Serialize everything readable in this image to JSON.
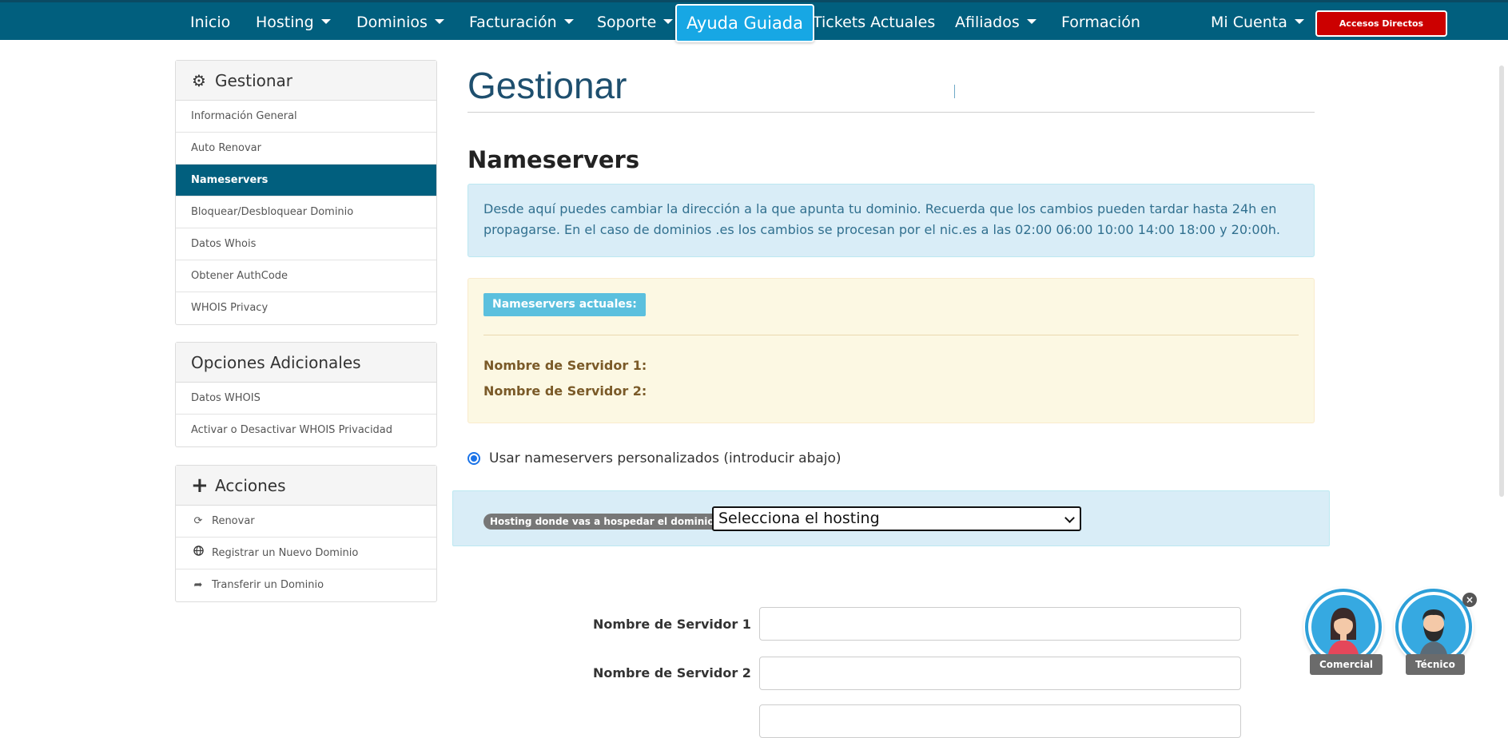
{
  "nav": {
    "inicio": "Inicio",
    "hosting": "Hosting",
    "dominios": "Dominios",
    "facturacion": "Facturación",
    "soporte": "Soporte",
    "ayuda_guiada": "Ayuda Guiada",
    "tickets": "Tickets Actuales",
    "afiliados": "Afiliados",
    "formacion": "Formación",
    "mi_cuenta": "Mi Cuenta",
    "accesos_directos": "Accesos Directos",
    "colors": {
      "bar": "#015f7e",
      "ayuda": "#17a7e4",
      "accesos": "#cc0000"
    }
  },
  "sidebar": {
    "gestionar": {
      "title": "Gestionar",
      "icon": "gear-icon",
      "items": [
        {
          "label": "Información General"
        },
        {
          "label": "Auto Renovar"
        },
        {
          "label": "Nameservers",
          "active": true
        },
        {
          "label": "Bloquear/Desbloquear Dominio"
        },
        {
          "label": "Datos Whois"
        },
        {
          "label": "Obtener AuthCode"
        },
        {
          "label": "WHOIS Privacy"
        }
      ]
    },
    "opciones": {
      "title": "Opciones Adicionales",
      "items": [
        {
          "label": "Datos WHOIS"
        },
        {
          "label": "Activar o Desactivar WHOIS Privacidad"
        }
      ]
    },
    "acciones": {
      "title": "Acciones",
      "icon": "plus-icon",
      "items": [
        {
          "label": "Renovar",
          "icon": "refresh-icon"
        },
        {
          "label": "Registrar un Nuevo Dominio",
          "icon": "globe-icon"
        },
        {
          "label": "Transferir un Dominio",
          "icon": "share-icon"
        }
      ]
    }
  },
  "main": {
    "page_title": "Gestionar",
    "section_title": "Nameservers",
    "info_text": "Desde aquí puedes cambiar la dirección a la que apunta tu dominio. Recuerda que los cambios pueden tardar hasta 24h en propagarse. En el caso de dominios .es los cambios se procesan por el nic.es a las 02:00 06:00 10:00 14:00 18:00 y 20:00h.",
    "current_label": "Nameservers actuales:",
    "current_ns1": "Nombre de Servidor 1:",
    "current_ns2": "Nombre de Servidor 2:",
    "radio_label": "Usar nameservers personalizados (introducir abajo)",
    "hosting_label": "Hosting donde vas a hospedar el dominio:",
    "hosting_select": "Selecciona el hosting",
    "field_ns1_label": "Nombre de Servidor 1",
    "field_ns2_label": "Nombre de Servidor 2",
    "field_ns1_value": "",
    "field_ns2_value": ""
  },
  "chat": {
    "comercial": "Comercial",
    "tecnico": "Técnico",
    "close": "×"
  }
}
